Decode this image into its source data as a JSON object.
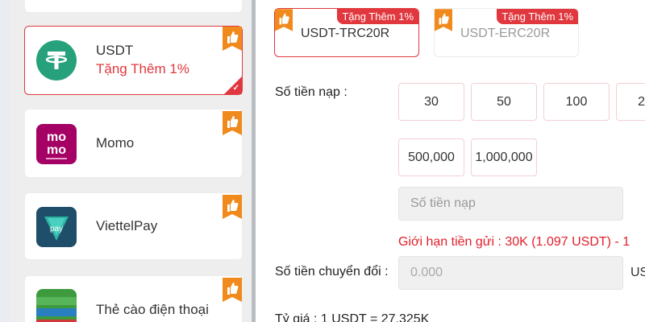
{
  "payment_methods": [
    {
      "name": "USDT",
      "bonus": "Tặng Thêm 1%",
      "icon": "tether-icon",
      "selected": true
    },
    {
      "name": "Momo",
      "icon": "momo-logo"
    },
    {
      "name": "ViettelPay",
      "icon": "viettelpay-logo"
    },
    {
      "name": "Thẻ cào điện thoại",
      "icon": "phone-card-logo"
    }
  ],
  "networks": [
    {
      "label": "USDT-TRC20R",
      "badge": "Tặng Thêm 1%",
      "active": true
    },
    {
      "label": "USDT-ERC20R",
      "badge": "Tặng Thêm 1%",
      "active": false
    }
  ],
  "deposit": {
    "amount_label": "Số tiền nạp :",
    "quick_amounts": [
      "30",
      "50",
      "100",
      "2",
      "500,000",
      "1,000,000"
    ],
    "input_placeholder": "Số tiền nạp",
    "limit_text": "Giới hạn tiền gửi :  30K (1.097 USDT)  -  1",
    "convert_label": "Số tiền chuyển đổi :",
    "convert_value": "0.000",
    "convert_unit": "US",
    "rate_text": "Tỷ giá :  1  USDT  =  27.325K"
  },
  "colors": {
    "accent": "#e0383e",
    "tether": "#26a17b",
    "momo": "#a50064"
  }
}
